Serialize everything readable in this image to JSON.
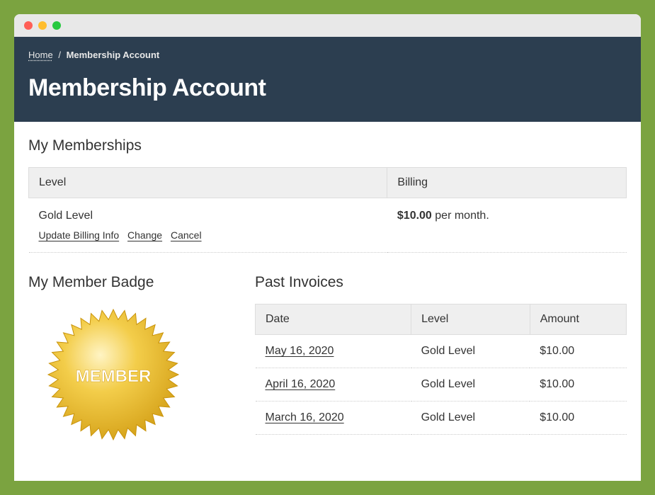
{
  "breadcrumb": {
    "home": "Home",
    "sep": "/",
    "current": "Membership Account"
  },
  "page_title": "Membership Account",
  "memberships": {
    "heading": "My Memberships",
    "col_level": "Level",
    "col_billing": "Billing",
    "level_name": "Gold Level",
    "billing_amount": "$10.00",
    "billing_suffix": " per month.",
    "action_update": "Update Billing Info",
    "action_change": "Change",
    "action_cancel": "Cancel"
  },
  "badge": {
    "heading": "My Member Badge",
    "text": "MEMBER"
  },
  "invoices": {
    "heading": "Past Invoices",
    "col_date": "Date",
    "col_level": "Level",
    "col_amount": "Amount",
    "rows": [
      {
        "date": "May 16, 2020",
        "level": "Gold Level",
        "amount": "$10.00"
      },
      {
        "date": "April 16, 2020",
        "level": "Gold Level",
        "amount": "$10.00"
      },
      {
        "date": "March 16, 2020",
        "level": "Gold Level",
        "amount": "$10.00"
      }
    ]
  }
}
